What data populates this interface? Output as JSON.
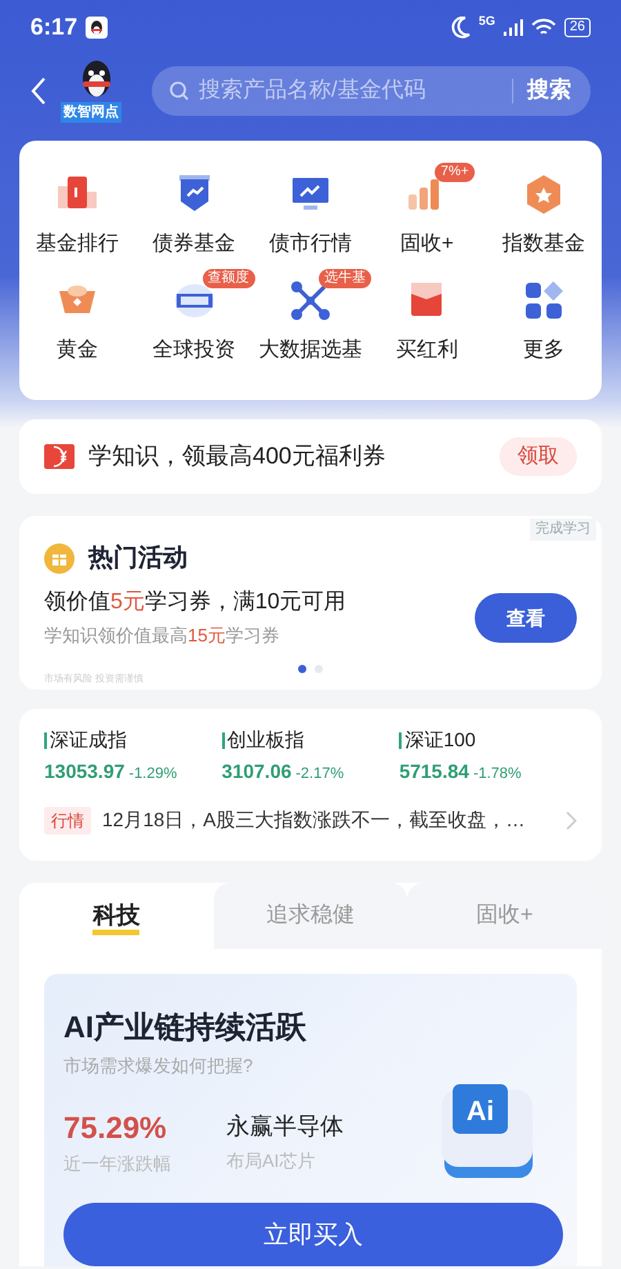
{
  "status_bar": {
    "time": "6:17",
    "network": "5G",
    "battery": "26"
  },
  "header": {
    "logo_label": "数智网点",
    "search": {
      "placeholder": "搜索产品名称/基金代码",
      "button": "搜索"
    }
  },
  "shortcuts": [
    {
      "label": "基金排行",
      "kind": "rank"
    },
    {
      "label": "债券基金",
      "kind": "bond"
    },
    {
      "label": "债市行情",
      "kind": "monitor"
    },
    {
      "label": "固收+",
      "kind": "bars",
      "badge": "7%+"
    },
    {
      "label": "指数基金",
      "kind": "hex"
    },
    {
      "label": "黄金",
      "kind": "gold"
    },
    {
      "label": "全球投资",
      "kind": "qdii",
      "badge": "查额度"
    },
    {
      "label": "大数据选基",
      "kind": "network",
      "badge": "选牛基"
    },
    {
      "label": "买红利",
      "kind": "envelope"
    },
    {
      "label": "更多",
      "kind": "grid"
    }
  ],
  "coupon_banner": {
    "text": "学知识，领最高400元福利券",
    "button": "领取"
  },
  "activity": {
    "corner_tag": "完成学习",
    "title": "热门活动",
    "line": [
      {
        "text": "领价值",
        "highlight": false
      },
      {
        "text": "5元",
        "highlight": true
      },
      {
        "text": "学习券，满10元可用",
        "highlight": false
      }
    ],
    "subline": [
      {
        "text": "学知识领价值最高",
        "highlight": false
      },
      {
        "text": "15元",
        "highlight": true
      },
      {
        "text": "学习券",
        "highlight": false
      }
    ],
    "button": "查看",
    "pages": [
      {
        "selected": true
      },
      {
        "selected": false
      }
    ],
    "disclaimer": "市场有风险 投资需谨慎"
  },
  "indices": [
    {
      "name": "深证成指",
      "value": "13053.97",
      "change": "-1.29%"
    },
    {
      "name": "创业板指",
      "value": "3107.06",
      "change": "-2.17%"
    },
    {
      "name": "深证100",
      "value": "5715.84",
      "change": "-1.78%"
    }
  ],
  "news": {
    "tag": "行情",
    "text": "12月18日，A股三大指数涨跌不一，截至收盘，…"
  },
  "tabs": [
    {
      "label": "科技",
      "selected": true
    },
    {
      "label": "追求稳健",
      "selected": false
    },
    {
      "label": "固收+",
      "selected": false
    }
  ],
  "feature": {
    "title": "AI产业链持续活跃",
    "subtitle": "市场需求爆发如何把握?",
    "stat": "75.29%",
    "stat_label": "近一年涨跌幅",
    "fund": "永赢半导体",
    "fund_note": "布局AI芯片",
    "illustration_text": "Ai",
    "button": "立即买入"
  }
}
